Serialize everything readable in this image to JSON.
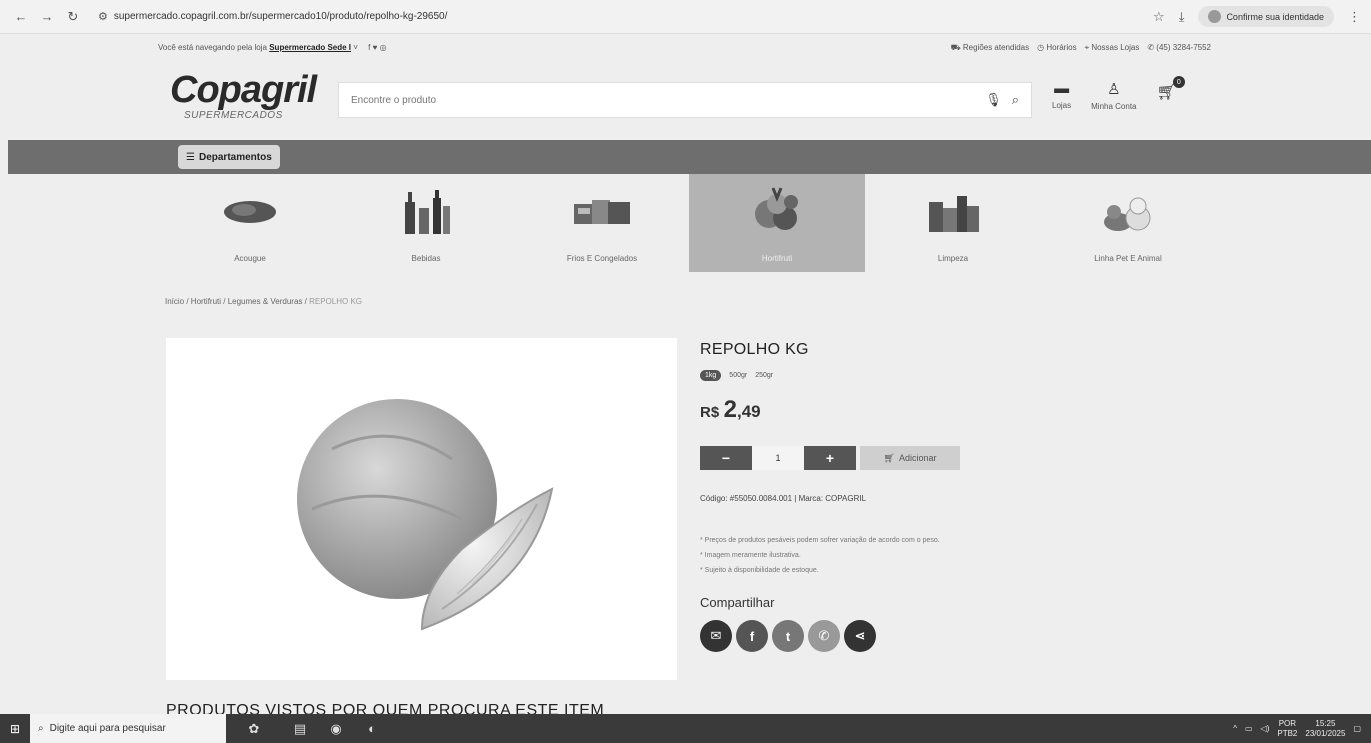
{
  "browser": {
    "url": "supermercado.copagril.com.br/supermercado10/produto/repolho-kg-29650/",
    "identity_label": "Confirme sua identidade"
  },
  "info_strip": {
    "store_prefix": "Você está navegando pela loja",
    "store_name": "Supermercado Sede I",
    "social": "f ♥ ◎",
    "links": [
      "Regiões atendidas",
      "Horários",
      "Nossas Lojas",
      "(45) 3284-7552"
    ]
  },
  "header": {
    "logo": "Copagril",
    "logo_sub": "SUPERMERCADOS",
    "search_placeholder": "Encontre o produto",
    "stores_label": "Lojas",
    "account_label": "Minha Conta",
    "cart_count": "0"
  },
  "departments_label": "Departamentos",
  "categories": [
    {
      "label": "Acougue",
      "icon": "meat-icon"
    },
    {
      "label": "Bebidas",
      "icon": "bottles-icon"
    },
    {
      "label": "Frios E Congelados",
      "icon": "frozen-icon"
    },
    {
      "label": "Hortifruti",
      "icon": "fruits-icon",
      "active": true
    },
    {
      "label": "Limpeza",
      "icon": "cleaning-icon"
    },
    {
      "label": "Linha Pet E Animal",
      "icon": "pets-icon"
    }
  ],
  "breadcrumb": {
    "items": [
      "Início",
      "Hortifruti",
      "Legumes & Verduras"
    ],
    "current": "REPOLHO KG"
  },
  "product": {
    "title": "REPOLHO KG",
    "sizes": [
      "1kg",
      "500gr",
      "250gr"
    ],
    "price_currency": "R$",
    "price_int": "2",
    "price_dec": ",49",
    "quantity": "1",
    "add_label": "Adicionar",
    "code_line": "Código: #55050.0084.001 | Marca: COPAGRIL",
    "notes": [
      "* Preços de produtos pesáveis podem sofrer variação de acordo com o peso.",
      "* Imagem meramente ilustrativa.",
      "* Sujeito à disponibilidade de estoque."
    ],
    "share_title": "Compartilhar"
  },
  "section_title": "PRODUTOS VISTOS POR QUEM PROCURA ESTE ITEM",
  "taskbar": {
    "search_placeholder": "Digite aqui para pesquisar",
    "lang": "POR",
    "lang2": "PTB2",
    "time": "15:25",
    "date": "23/01/2025"
  }
}
